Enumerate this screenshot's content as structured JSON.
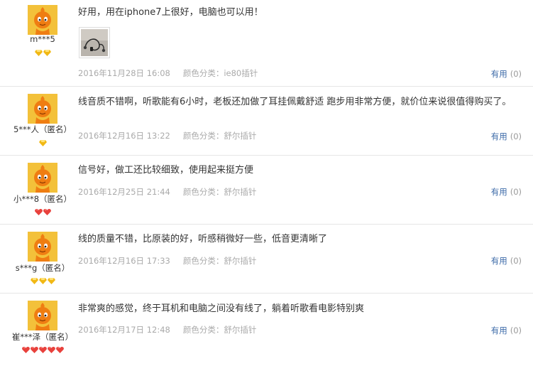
{
  "reviews": [
    {
      "user": "m***5",
      "badge_type": "gold",
      "badge_count": 2,
      "content": "好用，用在iphone7上很好，电脑也可以用！",
      "has_image": true,
      "date": "2016年11月28日 16:08",
      "sku_label": "颜色分类：",
      "sku_value": "ie80插针",
      "useful_label": "有用",
      "useful_count": "(0)"
    },
    {
      "user": "5***人（匿名）",
      "badge_type": "gold",
      "badge_count": 1,
      "content": "线音质不错啊，听歌能有6小时，老板还加做了耳挂佩戴舒适 跑步用非常方便，就价位来说很值得购买了。",
      "has_image": false,
      "date": "2016年12月16日 13:22",
      "sku_label": "颜色分类：",
      "sku_value": "舒尔插针",
      "useful_label": "有用",
      "useful_count": "(0)"
    },
    {
      "user": "小***8（匿名）",
      "badge_type": "red",
      "badge_count": 2,
      "content": "信号好，做工还比较细致，使用起来挺方便",
      "has_image": false,
      "date": "2016年12月25日 21:44",
      "sku_label": "颜色分类：",
      "sku_value": "舒尔插针",
      "useful_label": "有用",
      "useful_count": "(0)"
    },
    {
      "user": "s***g（匿名）",
      "badge_type": "gold",
      "badge_count": 3,
      "content": "线的质量不错，比原装的好，听感稍微好一些，低音更清晰了",
      "has_image": false,
      "date": "2016年12月16日 17:33",
      "sku_label": "颜色分类：",
      "sku_value": "舒尔插针",
      "useful_label": "有用",
      "useful_count": "(0)"
    },
    {
      "user": "崔***泽（匿名）",
      "badge_type": "red",
      "badge_count": 5,
      "content": "非常爽的感觉，终于耳机和电脑之间没有线了，躺着听歌看电影特别爽",
      "has_image": false,
      "date": "2016年12月17日 12:48",
      "sku_label": "颜色分类：",
      "sku_value": "舒尔插针",
      "useful_label": "有用",
      "useful_count": "(0)"
    }
  ],
  "colors": {
    "avatar_bg": "#f3c13a",
    "mascot": "#ef7d12",
    "badge_gold": "#f1b814",
    "badge_red": "#e8413c",
    "link": "#3c6aa8",
    "meta": "#aaaaaa",
    "divider": "#e6e6e6"
  },
  "icons": {
    "avatar": "taobao-mascot-avatar-icon",
    "badge_gold": "gold-diamond-icon",
    "badge_red": "red-heart-icon",
    "thumb": "earphone-photo-thumbnail"
  }
}
